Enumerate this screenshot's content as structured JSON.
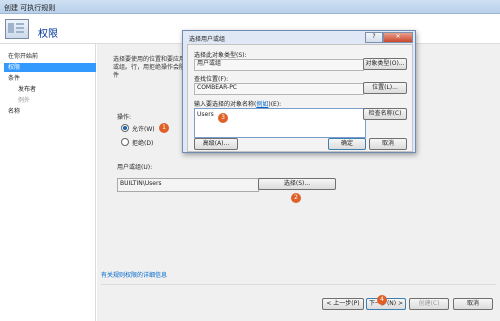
{
  "window": {
    "title": "创建 可执行规则"
  },
  "header": {
    "title": "权限"
  },
  "sidebar": {
    "items": [
      {
        "label": "在你开始前"
      },
      {
        "label": "权限",
        "selected": true
      },
      {
        "label": "条件"
      },
      {
        "label": "发布者"
      },
      {
        "label": "例外"
      },
      {
        "label": "名称"
      }
    ]
  },
  "content": {
    "description": "选择要使用的位置和要应用此规则的用户或组。行，用拒绝操作会阻止要影响的文件",
    "operation_label": "操作:",
    "allow_label": "允许(W)",
    "deny_label": "拒绝(D)",
    "user_group_label": "用户或组(U):",
    "user_group_value": "BUILTIN\\Users",
    "select_button": "选择(S)...",
    "help_link": "有关规则权限的详细信息"
  },
  "footer": {
    "prev": "< 上一步(P)",
    "next": "下一步(N) >",
    "create": "创建(C)",
    "cancel": "取消"
  },
  "dialog": {
    "title": "选择用户或组",
    "help_glyph": "?",
    "close_glyph": "✕",
    "object_type_label": "选择此对象类型(S):",
    "object_type_value": "用户或组",
    "object_types_button": "对象类型(O)...",
    "location_label": "查找位置(F):",
    "location_value": "COMBEAR-PC",
    "locations_button": "位置(L)...",
    "names_label_prefix": "输入要选择的对象名称(",
    "names_label_link": "例如",
    "names_label_suffix": ")(E):",
    "names_value": "Users",
    "check_names_button": "检查名称(C)",
    "advanced_button": "高级(A)...",
    "ok_button": "确定",
    "cancel_button": "取消"
  },
  "badges": [
    "1",
    "2",
    "3",
    "4"
  ],
  "colors": {
    "accent": "#3399ff",
    "badge": "#e0602a",
    "link": "#0066cc",
    "header_title": "#003399"
  }
}
